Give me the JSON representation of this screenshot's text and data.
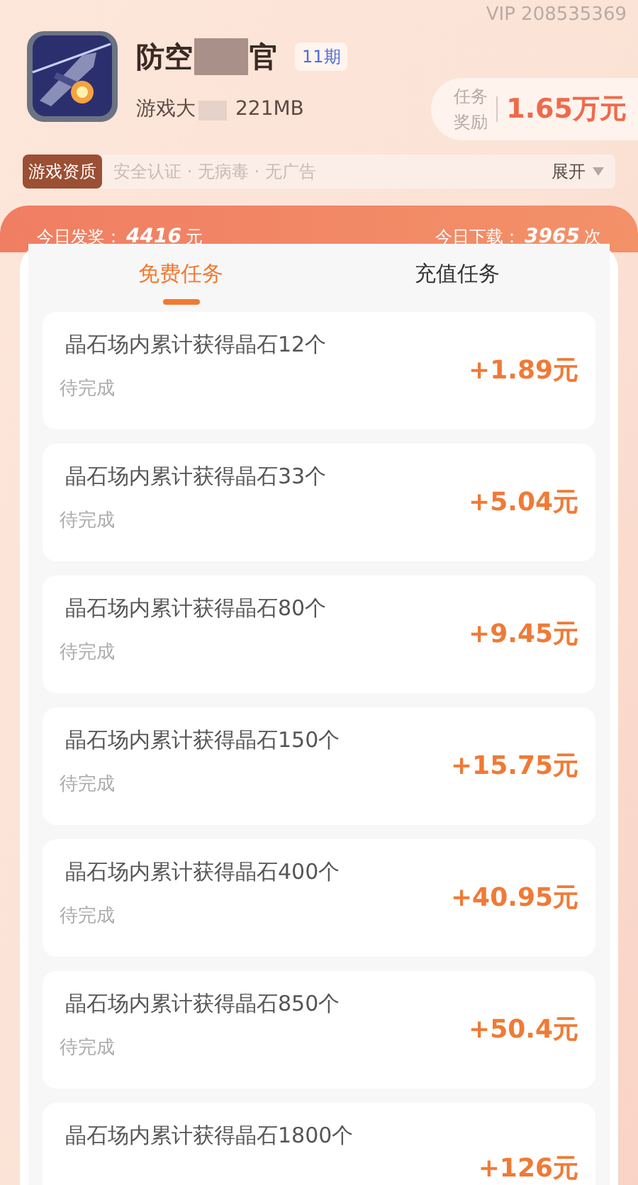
{
  "vip": "VIP 208535369",
  "game": {
    "title_start": "防空",
    "title_end": "官",
    "issue": "11期",
    "size_label": "游戏大",
    "size": "221MB"
  },
  "reward": {
    "label_top": "任务",
    "label_bottom": "奖励",
    "amount": "1.65万元"
  },
  "qualification": {
    "tag": "游戏资质",
    "items": [
      "安全认证",
      "无病毒",
      "无广告"
    ],
    "separator": "·",
    "expand": "展开"
  },
  "stats": [
    {
      "label": "今日发奖：",
      "value": "4416",
      "unit": "元"
    },
    {
      "label": "今日下载：",
      "value": "3965",
      "unit": "次"
    }
  ],
  "tabs": [
    {
      "label": "免费任务",
      "selected": true
    },
    {
      "label": "充值任务",
      "selected": false
    }
  ],
  "tasks": [
    {
      "title": "晶石场内累计获得晶石12个",
      "status": "待完成",
      "reward": "+1.89元"
    },
    {
      "title": "晶石场内累计获得晶石33个",
      "status": "待完成",
      "reward": "+5.04元"
    },
    {
      "title": "晶石场内累计获得晶石80个",
      "status": "待完成",
      "reward": "+9.45元"
    },
    {
      "title": "晶石场内累计获得晶石150个",
      "status": "待完成",
      "reward": "+15.75元"
    },
    {
      "title": "晶石场内累计获得晶石400个",
      "status": "待完成",
      "reward": "+40.95元"
    },
    {
      "title": "晶石场内累计获得晶石850个",
      "status": "待完成",
      "reward": "+50.4元"
    },
    {
      "title": "晶石场内累计获得晶石1800个",
      "reward": "+126元"
    }
  ]
}
